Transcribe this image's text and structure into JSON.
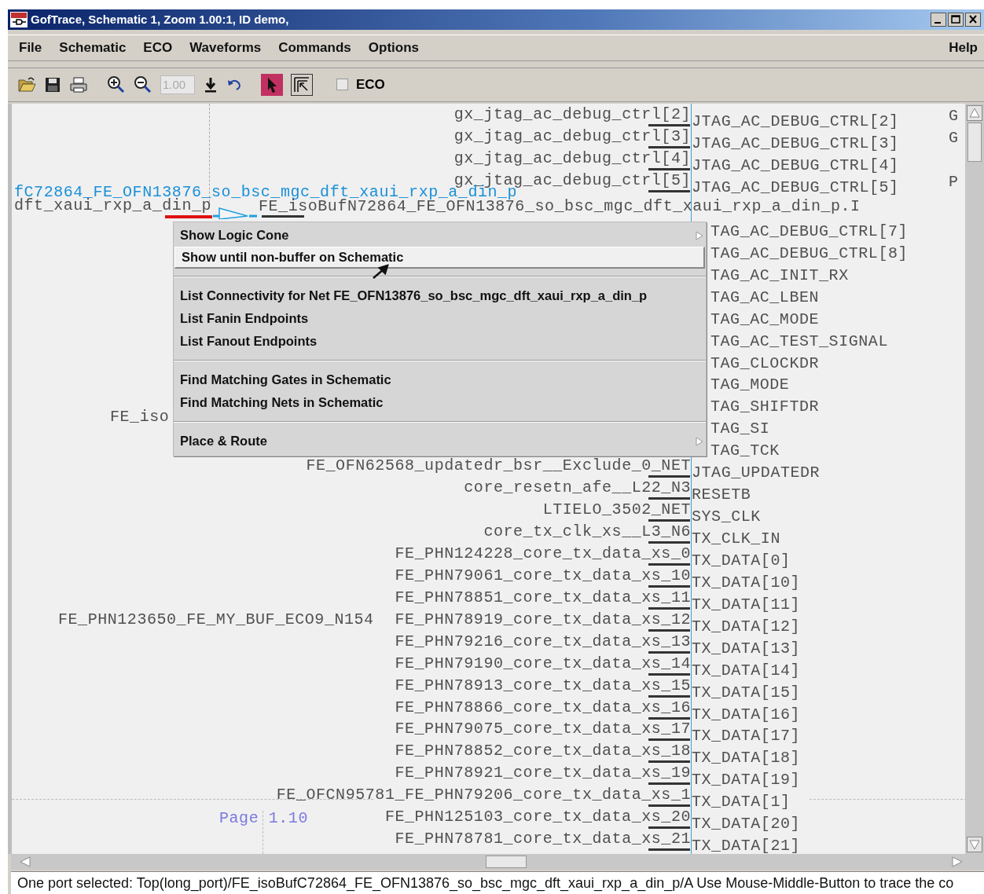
{
  "window": {
    "title": "GofTrace, Schematic 1, Zoom 1.00:1, ID demo,"
  },
  "menu_bar": [
    {
      "label": "File"
    },
    {
      "label": "Schematic"
    },
    {
      "label": "ECO"
    },
    {
      "label": "Waveforms"
    },
    {
      "label": "Commands"
    },
    {
      "label": "Options"
    }
  ],
  "help_menu": {
    "label": "Help"
  },
  "toolbar": [
    {
      "kind": "open"
    },
    {
      "kind": "save"
    },
    {
      "kind": "print"
    },
    {
      "kind": "zoom-in"
    },
    {
      "kind": "zoom-out"
    },
    {
      "kind": "field",
      "value": "1.00",
      "disabled": true
    },
    {
      "kind": "download"
    },
    {
      "kind": "undo"
    },
    {
      "kind": "select",
      "selected": true
    },
    {
      "kind": "trace",
      "selected": false
    },
    {
      "kind": "checkbox",
      "label": "ECO",
      "checked": false
    }
  ],
  "schematic": {
    "selected_net": {
      "label": "fC72864_FE_OFN13876_so_bsc_mgc_dft_xaui_rxp_a_din_p"
    },
    "buffer_input": {
      "label": "dft_xaui_rxp_a_din_p"
    },
    "buffer_output": {
      "label": "FE_isoBufN72864_FE_OFN13876_so_bsc_mgc_dft_xaui_rxp_a_din_p.I"
    },
    "side_label": {
      "label": "FE_iso"
    },
    "page_label": {
      "label": "Page 1.10"
    },
    "edge_letters": [
      {
        "label": "G"
      },
      {
        "label": "G"
      },
      {
        "label": "P"
      }
    ],
    "pins": [
      {
        "net": "gx_jtag_ac_debug_ctrl[2]",
        "port": "JTAG_AC_DEBUG_CTRL[2]"
      },
      {
        "net": "gx_jtag_ac_debug_ctrl[3]",
        "port": "JTAG_AC_DEBUG_CTRL[3]"
      },
      {
        "net": "gx_jtag_ac_debug_ctrl[4]",
        "port": "JTAG_AC_DEBUG_CTRL[4]"
      },
      {
        "net": "gx_jtag_ac_debug_ctrl[5]",
        "port": "JTAG_AC_DEBUG_CTRL[5]"
      }
    ],
    "pins_below_buffer": [
      {
        "port": "TAG_AC_DEBUG_CTRL[7]"
      },
      {
        "port": "TAG_AC_DEBUG_CTRL[8]"
      },
      {
        "port": "TAG_AC_INIT_RX"
      },
      {
        "port": "TAG_AC_LBEN"
      },
      {
        "port": "TAG_AC_MODE"
      },
      {
        "port": "TAG_AC_TEST_SIGNAL"
      },
      {
        "port": "TAG_CLOCKDR"
      },
      {
        "port": "TAG_MODE"
      },
      {
        "port": "TAG_SHIFTDR"
      },
      {
        "port": "TAG_SI"
      },
      {
        "port": "TAG_TCK"
      },
      {
        "net": "FE_OFN62568_updatedr_bsr__Exclude_0_NET",
        "port": "JTAG_UPDATEDR"
      },
      {
        "net": "core_resetn_afe__L22_N3",
        "port": "RESETB"
      },
      {
        "net": "LTIELO_3502_NET",
        "port": "SYS_CLK"
      },
      {
        "net": "core_tx_clk_xs__L3_N6",
        "port": "TX_CLK_IN"
      },
      {
        "net": "FE_PHN124228_core_tx_data_xs_0",
        "port": "TX_DATA[0]"
      },
      {
        "net": "FE_PHN79061_core_tx_data_xs_10",
        "port": "TX_DATA[10]"
      },
      {
        "net": "FE_PHN78851_core_tx_data_xs_11",
        "port": "TX_DATA[11]"
      },
      {
        "net": "FE_PHN78919_core_tx_data_xs_12",
        "port": "TX_DATA[12]",
        "driver": "FE_PHN123650_FE_MY_BUF_ECO9_N154"
      },
      {
        "net": "FE_PHN79216_core_tx_data_xs_13",
        "port": "TX_DATA[13]"
      },
      {
        "net": "FE_PHN79190_core_tx_data_xs_14",
        "port": "TX_DATA[14]"
      },
      {
        "net": "FE_PHN78913_core_tx_data_xs_15",
        "port": "TX_DATA[15]"
      },
      {
        "net": "FE_PHN78866_core_tx_data_xs_16",
        "port": "TX_DATA[16]"
      },
      {
        "net": "FE_PHN79075_core_tx_data_xs_17",
        "port": "TX_DATA[17]"
      },
      {
        "net": "FE_PHN78852_core_tx_data_xs_18",
        "port": "TX_DATA[18]"
      },
      {
        "net": "FE_PHN78921_core_tx_data_xs_19",
        "port": "TX_DATA[19]"
      },
      {
        "net": "FE_OFCN95781_FE_PHN79206_core_tx_data_xs_1",
        "port": "TX_DATA[1]"
      },
      {
        "net": "FE_PHN125103_core_tx_data_xs_20",
        "port": "TX_DATA[20]"
      },
      {
        "net": "FE_PHN78781_core_tx_data_xs_21",
        "port": "TX_DATA[21]"
      }
    ]
  },
  "context_menu": [
    {
      "kind": "item",
      "label": "Show Logic Cone",
      "selected": false,
      "submenu": true
    },
    {
      "kind": "item",
      "label": "Show until non-buffer on Schematic",
      "selected": true,
      "submenu": false
    },
    {
      "kind": "separator"
    },
    {
      "kind": "item",
      "label": "List Connectivity for Net FE_OFN13876_so_bsc_mgc_dft_xaui_rxp_a_din_p",
      "selected": false,
      "submenu": false
    },
    {
      "kind": "item",
      "label": "List Fanin Endpoints",
      "selected": false,
      "submenu": false
    },
    {
      "kind": "item",
      "label": "List Fanout Endpoints",
      "selected": false,
      "submenu": false
    },
    {
      "kind": "separator"
    },
    {
      "kind": "item",
      "label": "Find Matching Gates in Schematic",
      "selected": false,
      "submenu": false
    },
    {
      "kind": "item",
      "label": "Find Matching Nets in Schematic",
      "selected": false,
      "submenu": false
    },
    {
      "kind": "separator"
    },
    {
      "kind": "item",
      "label": "Place & Route",
      "selected": false,
      "submenu": true
    }
  ],
  "status_bar": {
    "text": "One port selected: Top(long_port)/FE_isoBufC72864_FE_OFN13876_so_bsc_mgc_dft_xaui_rxp_a_din_p/A   Use Mouse-Middle-Button to trace the co"
  }
}
